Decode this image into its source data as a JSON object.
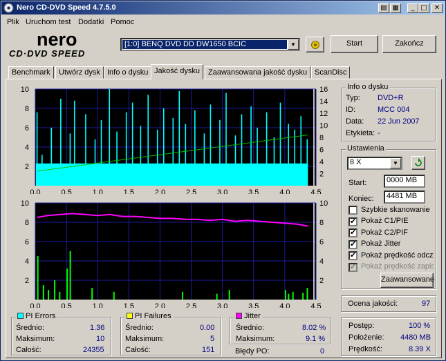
{
  "window": {
    "title": "Nero CD-DVD Speed 4.7.5.0"
  },
  "menu": [
    "Plik",
    "Uruchom test",
    "Dodatki",
    "Pomoc"
  ],
  "drive": {
    "selected": "[1:0]   BENQ DVD DD DW1650 BCIC"
  },
  "buttons": {
    "start": "Start",
    "close": "Zakończ",
    "advanced": "Zaawansowane"
  },
  "tabs": [
    "Benchmark",
    "Utwórz dysk",
    "Info o dysku",
    "Jakość dysku",
    "Zaawansowana jakość dysku",
    "ScanDisc"
  ],
  "active_tab": "Jakość dysku",
  "disc_info": {
    "title": "Info o dysku",
    "rows": [
      {
        "label": "Typ:",
        "value": "DVD+R"
      },
      {
        "label": "ID:",
        "value": "MCC 004"
      },
      {
        "label": "Data:",
        "value": "22 Jun 2007"
      },
      {
        "label": "Etykieta:",
        "value": "-"
      }
    ]
  },
  "settings": {
    "title": "Ustawienia",
    "speed": "8 X",
    "start_label": "Start:",
    "start_value": "0000 MB",
    "end_label": "Koniec:",
    "end_value": "4481 MB",
    "checkboxes": [
      {
        "label": "Szybkie skanowanie",
        "checked": false,
        "disabled": false
      },
      {
        "label": "Pokaż C1/PIE",
        "checked": true,
        "disabled": false
      },
      {
        "label": "Pokaż C2/PIF",
        "checked": true,
        "disabled": false
      },
      {
        "label": "Pokaż Jitter",
        "checked": true,
        "disabled": false
      },
      {
        "label": "Pokaż prędkość odczytu",
        "checked": true,
        "disabled": false
      },
      {
        "label": "Pokaż prędkość zapisu",
        "checked": true,
        "disabled": true
      }
    ]
  },
  "quality": {
    "label": "Ocena jakości:",
    "value": "97"
  },
  "pi_errors": {
    "title": "PI Errors",
    "color": "#00ffff",
    "rows": [
      {
        "label": "Średnio:",
        "value": "1.36"
      },
      {
        "label": "Maksimum:",
        "value": "10"
      },
      {
        "label": "Całość:",
        "value": "24355"
      }
    ]
  },
  "pi_failures": {
    "title": "PI Failures",
    "color": "#ffff00",
    "rows": [
      {
        "label": "Średnio:",
        "value": "0.00"
      },
      {
        "label": "Maksimum:",
        "value": "5"
      },
      {
        "label": "Całość:",
        "value": "151"
      }
    ]
  },
  "jitter": {
    "title": "Jitter",
    "color": "#ff00ff",
    "rows": [
      {
        "label": "Średnio:",
        "value": "8.02 %"
      },
      {
        "label": "Maksimum:",
        "value": "9.1 %"
      },
      {
        "label": "Błędy PO:",
        "value": "0"
      }
    ]
  },
  "progress": {
    "rows": [
      {
        "label": "Postęp:",
        "value": "100 %"
      },
      {
        "label": "Położenie:",
        "value": "4480 MB"
      },
      {
        "label": "Prędkość:",
        "value": "8.39 X"
      }
    ]
  },
  "chart_data": [
    {
      "type": "bar",
      "name": "PI Errors / read speed",
      "x_ticks": [
        "0.0",
        "0.5",
        "1.0",
        "1.5",
        "2.0",
        "2.5",
        "3.0",
        "3.5",
        "4.0",
        "4.5"
      ],
      "xlim": [
        0,
        4.5
      ],
      "y_left_ticks": [
        "10",
        "8",
        "6",
        "4",
        "2"
      ],
      "y_left_lim": [
        0,
        10
      ],
      "y_right_ticks": [
        "16",
        "14",
        "12",
        "10",
        "8",
        "6",
        "4",
        "2"
      ],
      "y_right_lim": [
        0,
        16
      ],
      "pi_errors_avg": 1.36,
      "pi_errors_max": 10,
      "pi_errors_baseline": 2.3,
      "pi_errors_data_end": 4.37,
      "pi_errors_spikes": [
        {
          "x": 0.02,
          "y": 7.6
        },
        {
          "x": 0.1,
          "y": 3.2
        },
        {
          "x": 0.25,
          "y": 6.0
        },
        {
          "x": 0.4,
          "y": 9.0
        },
        {
          "x": 0.55,
          "y": 5.4
        },
        {
          "x": 0.62,
          "y": 8.8
        },
        {
          "x": 0.8,
          "y": 7.4
        },
        {
          "x": 0.95,
          "y": 4.8
        },
        {
          "x": 1.05,
          "y": 6.8
        },
        {
          "x": 1.18,
          "y": 10.0
        },
        {
          "x": 1.3,
          "y": 5.6
        },
        {
          "x": 1.45,
          "y": 7.6
        },
        {
          "x": 1.55,
          "y": 8.6
        },
        {
          "x": 1.68,
          "y": 6.2
        },
        {
          "x": 1.8,
          "y": 9.4
        },
        {
          "x": 1.95,
          "y": 5.8
        },
        {
          "x": 2.05,
          "y": 8.0
        },
        {
          "x": 2.2,
          "y": 7.0
        },
        {
          "x": 2.3,
          "y": 9.8
        },
        {
          "x": 2.4,
          "y": 6.4
        },
        {
          "x": 2.55,
          "y": 7.8
        },
        {
          "x": 2.7,
          "y": 5.4
        },
        {
          "x": 2.8,
          "y": 8.4
        },
        {
          "x": 2.95,
          "y": 6.8
        },
        {
          "x": 3.05,
          "y": 9.6
        },
        {
          "x": 3.2,
          "y": 5.2
        },
        {
          "x": 3.3,
          "y": 7.4
        },
        {
          "x": 3.45,
          "y": 8.2
        },
        {
          "x": 3.55,
          "y": 6.0
        },
        {
          "x": 3.7,
          "y": 7.6
        },
        {
          "x": 3.82,
          "y": 5.0
        },
        {
          "x": 3.92,
          "y": 8.6
        },
        {
          "x": 4.05,
          "y": 6.4
        },
        {
          "x": 4.15,
          "y": 5.8
        },
        {
          "x": 4.25,
          "y": 7.2
        },
        {
          "x": 4.35,
          "y": 4.8
        }
      ],
      "read_speed": {
        "x": [
          0.03,
          4.37
        ],
        "y": [
          2.4,
          8.4
        ]
      }
    },
    {
      "type": "bar",
      "name": "PI Failures / Jitter",
      "x_ticks": [
        "0.0",
        "0.5",
        "1.0",
        "1.5",
        "2.0",
        "2.5",
        "3.0",
        "3.5",
        "4.0",
        "4.5"
      ],
      "xlim": [
        0,
        4.5
      ],
      "y_left_ticks": [
        "10",
        "8",
        "6",
        "4",
        "2"
      ],
      "y_left_lim": [
        0,
        10
      ],
      "y_right_ticks": [
        "10",
        "8",
        "6",
        "4",
        "2"
      ],
      "y_right_lim": [
        0,
        10
      ],
      "pi_failures": [
        {
          "x": 0.03,
          "y": 4.5
        },
        {
          "x": 0.12,
          "y": 1.5
        },
        {
          "x": 0.2,
          "y": 1.0
        },
        {
          "x": 0.3,
          "y": 2.0
        },
        {
          "x": 0.38,
          "y": 0.8
        },
        {
          "x": 0.5,
          "y": 3.2
        },
        {
          "x": 0.55,
          "y": 5.0
        },
        {
          "x": 0.9,
          "y": 1.2
        },
        {
          "x": 1.25,
          "y": 0.8
        },
        {
          "x": 2.35,
          "y": 0.8
        },
        {
          "x": 2.9,
          "y": 0.6
        },
        {
          "x": 3.1,
          "y": 1.0
        },
        {
          "x": 4.0,
          "y": 1.0
        },
        {
          "x": 4.05,
          "y": 0.6
        },
        {
          "x": 4.12,
          "y": 0.8
        },
        {
          "x": 4.28,
          "y": 0.7
        },
        {
          "x": 4.35,
          "y": 1.2
        }
      ],
      "jitter": {
        "x": [
          0.03,
          0.2,
          0.4,
          0.6,
          0.8,
          1.0,
          1.2,
          1.4,
          1.6,
          1.8,
          2.0,
          2.2,
          2.4,
          2.6,
          2.8,
          3.0,
          3.2,
          3.4,
          3.6,
          3.8,
          4.0,
          4.2,
          4.37
        ],
        "y": [
          8.5,
          8.7,
          8.8,
          8.9,
          8.8,
          8.7,
          8.8,
          8.6,
          8.6,
          8.5,
          8.4,
          8.4,
          8.3,
          8.3,
          8.2,
          8.3,
          8.1,
          8.2,
          8.1,
          8.0,
          7.9,
          7.8,
          7.6
        ]
      }
    }
  ]
}
